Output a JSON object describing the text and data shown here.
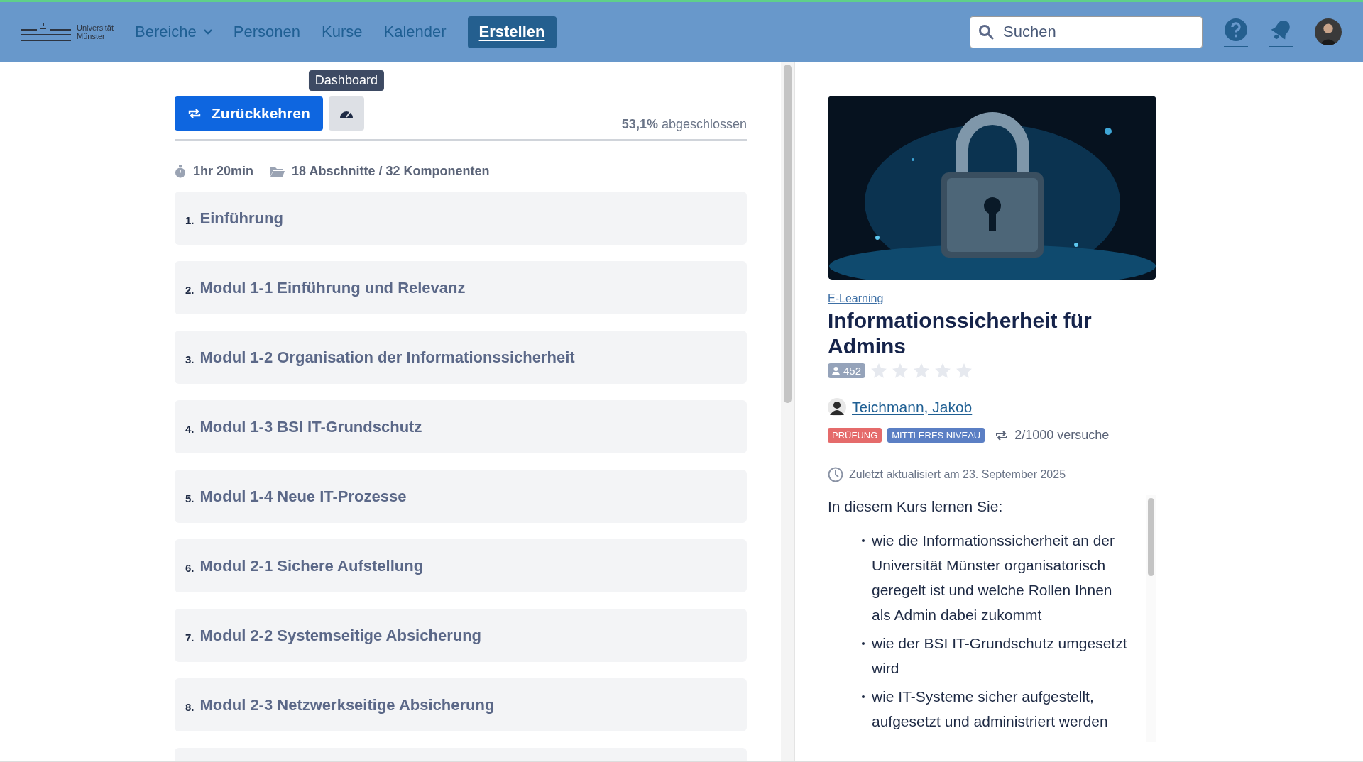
{
  "header": {
    "logo": {
      "line1": "Universität",
      "line2": "Münster"
    },
    "nav": [
      {
        "label": "Bereiche",
        "kind": "dropdown"
      },
      {
        "label": "Personen",
        "kind": "link"
      },
      {
        "label": "Kurse",
        "kind": "link"
      },
      {
        "label": "Kalender",
        "kind": "link"
      },
      {
        "label": "Erstellen",
        "kind": "button"
      }
    ],
    "search": {
      "placeholder": "Suchen"
    }
  },
  "course_nav": {
    "back_button": "Zurückkehren",
    "tooltip": "Dashboard",
    "progress": "**53,1%** abgeschlossen",
    "duration": "1hr 20min",
    "structure": "18 Abschnitte / 32 Komponenten"
  },
  "sections": [
    {
      "number": "1.",
      "title": "Einführung"
    },
    {
      "number": "2.",
      "title": "Modul 1-1 Einführung und Relevanz"
    },
    {
      "number": "3.",
      "title": "Modul 1-2 Organisation der Informationssicherheit"
    },
    {
      "number": "4.",
      "title": "Modul 1-3 BSI IT-Grundschutz"
    },
    {
      "number": "5.",
      "title": "Modul 1-4 Neue IT-Prozesse"
    },
    {
      "number": "6.",
      "title": "Modul 2-1 Sichere Aufstellung"
    },
    {
      "number": "7.",
      "title": "Modul 2-2 Systemseitige Absicherung"
    },
    {
      "number": "8.",
      "title": "Modul 2-3 Netzwerkseitige Absicherung"
    }
  ],
  "course": {
    "category": "E-Learning",
    "title": "Informationssicherheit für Admins",
    "participants": "452",
    "stars": 0,
    "author": "Teichmann, Jakob",
    "tags": [
      {
        "label": "PRÜFUNG",
        "color": "#e56b6b"
      },
      {
        "label": "MITTLERES NIVEAU",
        "color": "#5b7fc4"
      }
    ],
    "attempts": "2/1000 versuche",
    "updated": "Zuletzt aktualisiert am 23. September 2025",
    "description": {
      "intro": "In diesem Kurs lernen Sie:",
      "bullets": [
        "wie die Informationssicherheit an der Universität Münster organisatorisch geregelt ist und welche Rollen Ihnen als Admin dabei zukommt",
        "wie der BSI IT-Grundschutz umgesetzt wird",
        "wie IT-Systeme sicher aufgestellt, aufgesetzt und administriert werden"
      ]
    }
  }
}
